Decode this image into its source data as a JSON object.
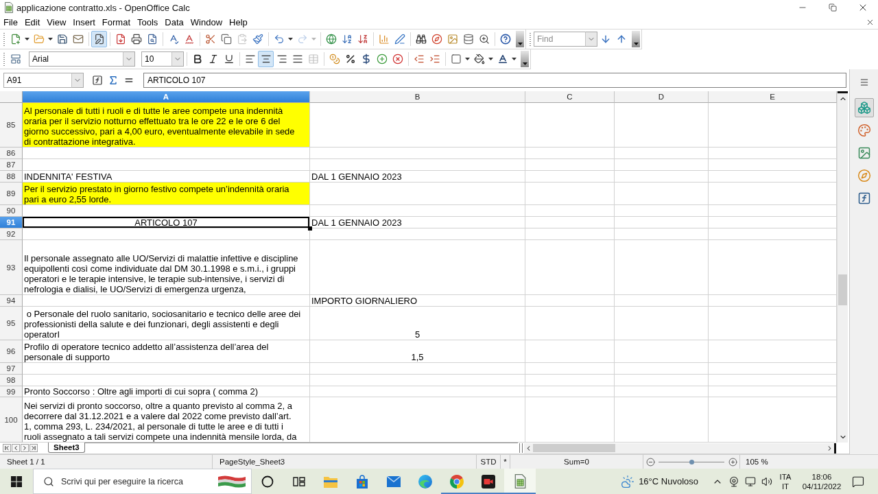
{
  "window": {
    "title": "applicazione contratto.xls - OpenOffice Calc"
  },
  "menu": [
    "File",
    "Edit",
    "View",
    "Insert",
    "Format",
    "Tools",
    "Data",
    "Window",
    "Help"
  ],
  "standard_toolbar": {
    "edit_file_on": true,
    "paste_disabled": true,
    "redo_disabled": true
  },
  "find_toolbar": {
    "placeholder": "Find"
  },
  "formatting_toolbar": {
    "font_name": "Arial",
    "font_size": "10",
    "alignment": [
      {
        "selected": false
      },
      {
        "selected": true
      },
      {
        "selected": false
      },
      {
        "selected": false
      }
    ],
    "merge_disabled": true
  },
  "formula_bar": {
    "name_box": "A91",
    "formula": "ARTICOLO 107"
  },
  "sheet": {
    "columns": [
      {
        "label": "A",
        "selected": true
      },
      {
        "label": "B",
        "selected": false
      },
      {
        "label": "C",
        "selected": false
      },
      {
        "label": "D",
        "selected": false
      },
      {
        "label": "E",
        "selected": false
      }
    ],
    "rows": [
      {
        "number": "85",
        "selected": false,
        "cells": [
          {
            "highlighted": true,
            "centered": false,
            "text": "Al personale di tutti i ruoli e di tutte le aree compete una indennità\noraria per il servizio notturno effettuato tra le ore 22 e le ore 6 del\ngiorno successivo, pari a 4,00 euro, eventualmente elevabile in sede\ndi contrattazione integrativa."
          },
          {
            "highlighted": false
          }
        ]
      },
      {
        "number": "86",
        "selected": false,
        "cells": [
          {
            "highlighted": false
          },
          {
            "highlighted": false
          }
        ]
      },
      {
        "number": "87",
        "selected": false,
        "cells": [
          {
            "highlighted": false
          },
          {
            "highlighted": false
          }
        ]
      },
      {
        "number": "88",
        "selected": false,
        "cells": [
          {
            "highlighted": false,
            "centered": false,
            "text": "INDENNITA' FESTIVA"
          },
          {
            "highlighted": false,
            "centered": false,
            "text": "DAL 1 GENNAIO 2023"
          }
        ]
      },
      {
        "number": "89",
        "selected": false,
        "cells": [
          {
            "highlighted": true,
            "centered": false,
            "text": "Per il servizio prestato in giorno festivo compete un’indennità oraria\npari a euro 2,55 lorde."
          },
          {
            "highlighted": false
          }
        ]
      },
      {
        "number": "90",
        "selected": false,
        "cells": [
          {
            "highlighted": false
          },
          {
            "highlighted": false
          }
        ]
      },
      {
        "number": "91",
        "selected": true,
        "cells": [
          {
            "highlighted": false,
            "centered": true,
            "text": "ARTICOLO 107"
          },
          {
            "highlighted": false,
            "centered": false,
            "text": "DAL 1 GENNAIO 2023"
          }
        ]
      },
      {
        "number": "92",
        "selected": false,
        "cells": [
          {
            "highlighted": false
          },
          {
            "highlighted": false
          }
        ]
      },
      {
        "number": "93",
        "selected": false,
        "cells": [
          {
            "highlighted": false,
            "centered": false,
            "text": "Il personale assegnato alle UO/Servizi di malattie infettive e discipline\nequipollenti così come individuate dal DM 30.1.1998 e s.m.i., i gruppi\noperatori e le terapie intensive, le terapie sub-intensive, i servizi di\nnefrologia e dialisi, le UO/Servizi di emergenza urgenza,"
          },
          {
            "highlighted": false
          }
        ]
      },
      {
        "number": "94",
        "selected": false,
        "cells": [
          {
            "highlighted": false
          },
          {
            "highlighted": false,
            "centered": false,
            "text": "IMPORTO GIORNALIERO"
          }
        ]
      },
      {
        "number": "95",
        "selected": false,
        "cells": [
          {
            "highlighted": false,
            "centered": false,
            "text": " o Personale del ruolo sanitario, sociosanitario e tecnico delle aree dei\nprofessionisti della salute e dei funzionari, degli assistenti e degli\noperatorI"
          },
          {
            "highlighted": false,
            "centered": true,
            "text": "5"
          }
        ]
      },
      {
        "number": "96",
        "selected": false,
        "cells": [
          {
            "highlighted": false,
            "centered": false,
            "text": "Profilo di operatore tecnico addetto all’assistenza dell’area del\npersonale di supporto"
          },
          {
            "highlighted": false,
            "centered": true,
            "text": "1,5"
          }
        ]
      },
      {
        "number": "97",
        "selected": false,
        "cells": [
          {
            "highlighted": false
          },
          {
            "highlighted": false
          }
        ]
      },
      {
        "number": "98",
        "selected": false,
        "cells": [
          {
            "highlighted": false
          },
          {
            "highlighted": false
          }
        ]
      },
      {
        "number": "99",
        "selected": false,
        "cells": [
          {
            "highlighted": false,
            "centered": false,
            "text": "Pronto Soccorso : Oltre agli importi di cui sopra ( comma 2)"
          },
          {
            "highlighted": false
          }
        ]
      },
      {
        "number": "100",
        "selected": false,
        "cells": [
          {
            "highlighted": false,
            "centered": false,
            "text": "Nei servizi di pronto soccorso, oltre a quanto previsto al comma 2, a\ndecorrere dal 31.12.2021 e a valere dal 2022 come previsto dall’art.\n1, comma 293, L. 234/2021, al personale di tutte le aree e di tutti i\nruoli assegnato a tali servizi compete una indennità mensile lorda, da"
          },
          {
            "highlighted": false
          }
        ]
      }
    ]
  },
  "sheet_tabs": [
    {
      "label": "Sheet3",
      "selected": true
    }
  ],
  "sidebar": {
    "decks": [
      {
        "selected": true
      },
      {
        "selected": false
      },
      {
        "selected": false
      },
      {
        "selected": false
      },
      {
        "selected": false
      }
    ]
  },
  "status_bar": {
    "sheet": "Sheet 1 / 1",
    "page_style": "PageStyle_Sheet3",
    "selection_mode": "STD",
    "modified": "*",
    "sum": "Sum=0",
    "zoom": {
      "level": 0.5,
      "reading": "105 %"
    }
  },
  "taskbar": {
    "search_placeholder": "Scrivi qui per eseguire la ricerca",
    "apps": [
      {
        "running": false,
        "selected": false
      },
      {
        "running": false,
        "selected": false
      },
      {
        "running": false,
        "selected": false
      },
      {
        "running": false,
        "selected": false
      },
      {
        "running": false,
        "selected": false
      },
      {
        "running": false,
        "selected": false
      },
      {
        "running": true,
        "selected": false
      },
      {
        "running": true,
        "selected": false
      },
      {
        "running": true,
        "selected": true
      }
    ],
    "weather": "16°C Nuvoloso",
    "language": [
      "ITA",
      "IT"
    ],
    "time": "18:06",
    "date": "04/11/2022"
  }
}
